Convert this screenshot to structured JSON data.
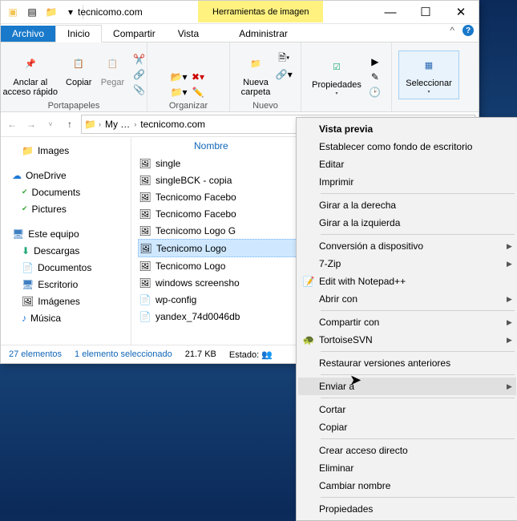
{
  "titlebar": {
    "title": "tecnicomo.com",
    "context_tab": "Herramientas de imagen"
  },
  "win": {
    "min": "—",
    "max": "☐",
    "close": "✕"
  },
  "tabs": {
    "archivo": "Archivo",
    "inicio": "Inicio",
    "compartir": "Compartir",
    "vista": "Vista",
    "administrar": "Administrar",
    "caret": "^"
  },
  "ribbon": {
    "pin": "Anclar al\nacceso rápido",
    "copiar": "Copiar",
    "pegar": "Pegar",
    "portapapeles": "Portapapeles",
    "organizar": "Organizar",
    "nueva": "Nueva\ncarpeta",
    "nuevo": "Nuevo",
    "propiedades": "Propiedades",
    "seleccionar": "Seleccionar"
  },
  "addr": {
    "root": "My …",
    "folder": "tecnicomo.com"
  },
  "tree": {
    "images": "Images",
    "onedrive": "OneDrive",
    "documents": "Documents",
    "pictures": "Pictures",
    "este": "Este equipo",
    "descargas": "Descargas",
    "documentos": "Documentos",
    "escritorio": "Escritorio",
    "imagenes": "Imágenes",
    "musica": "Música"
  },
  "files": {
    "col": "Nombre",
    "rows": [
      {
        "icon": "🖼",
        "name": "single"
      },
      {
        "icon": "🖼",
        "name": "singleBCK - copia"
      },
      {
        "icon": "🖼",
        "name": "Tecnicomo Facebo"
      },
      {
        "icon": "🖼",
        "name": "Tecnicomo Facebo"
      },
      {
        "icon": "🖼",
        "name": "Tecnicomo Logo G"
      },
      {
        "icon": "🖼",
        "name": "Tecnicomo Logo",
        "sel": true
      },
      {
        "icon": "🖼",
        "name": "Tecnicomo Logo"
      },
      {
        "icon": "🖼",
        "name": "windows screensho"
      },
      {
        "icon": "📄",
        "name": "wp-config"
      },
      {
        "icon": "📄",
        "name": "yandex_74d0046db"
      }
    ]
  },
  "status": {
    "count": "27 elementos",
    "sel": "1 elemento seleccionado",
    "size": "21.7 KB",
    "estado": "Estado:"
  },
  "ctx": [
    {
      "t": "Vista previa",
      "bold": true
    },
    {
      "t": "Establecer como fondo de escritorio"
    },
    {
      "t": "Editar"
    },
    {
      "t": "Imprimir"
    },
    {
      "sep": true
    },
    {
      "t": "Girar a la derecha"
    },
    {
      "t": "Girar a la izquierda"
    },
    {
      "sep": true
    },
    {
      "t": "Conversión a dispositivo",
      "arr": true
    },
    {
      "t": "7-Zip",
      "arr": true
    },
    {
      "t": "Edit with Notepad++",
      "icon": "📝"
    },
    {
      "t": "Abrir con",
      "arr": true
    },
    {
      "sep": true
    },
    {
      "t": "Compartir con",
      "arr": true
    },
    {
      "t": "TortoiseSVN",
      "icon": "🐢",
      "arr": true
    },
    {
      "sep": true
    },
    {
      "t": "Restaurar versiones anteriores"
    },
    {
      "sep": true
    },
    {
      "t": "Enviar a",
      "arr": true,
      "hl": true
    },
    {
      "sep": true
    },
    {
      "t": "Cortar"
    },
    {
      "t": "Copiar"
    },
    {
      "sep": true
    },
    {
      "t": "Crear acceso directo"
    },
    {
      "t": "Eliminar"
    },
    {
      "t": "Cambiar nombre"
    },
    {
      "sep": true
    },
    {
      "t": "Propiedades"
    }
  ]
}
